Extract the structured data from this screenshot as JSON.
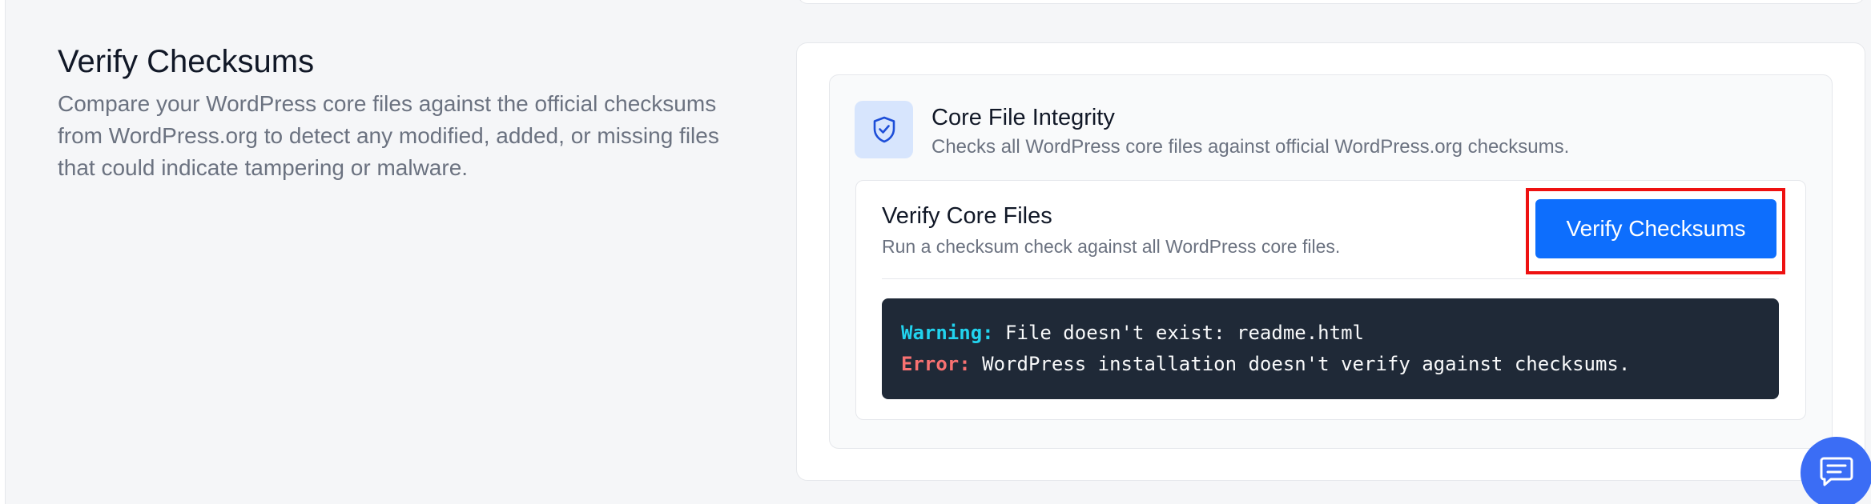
{
  "section": {
    "title": "Verify Checksums",
    "description": "Compare your WordPress core files against the official checksums from WordPress.org to detect any modified, added, or missing files that could indicate tampering or malware."
  },
  "integrity": {
    "icon": "shield-check-icon",
    "title": "Core File Integrity",
    "subtitle": "Checks all WordPress core files against official WordPress.org checksums."
  },
  "verify": {
    "title": "Verify Core Files",
    "subtitle": "Run a checksum check against all WordPress core files.",
    "button_label": "Verify Checksums"
  },
  "console": {
    "lines": [
      {
        "label": "Warning:",
        "message": " File doesn't exist: readme.html",
        "label_color": "#22d3ee"
      },
      {
        "label": "Error:",
        "message": " WordPress installation doesn't verify against checksums.",
        "label_color": "#f87171"
      }
    ]
  },
  "chat": {
    "icon": "chat-icon"
  },
  "colors": {
    "accent": "#0d6efd",
    "highlight": "#ee1111",
    "console_bg": "#1f2937"
  }
}
